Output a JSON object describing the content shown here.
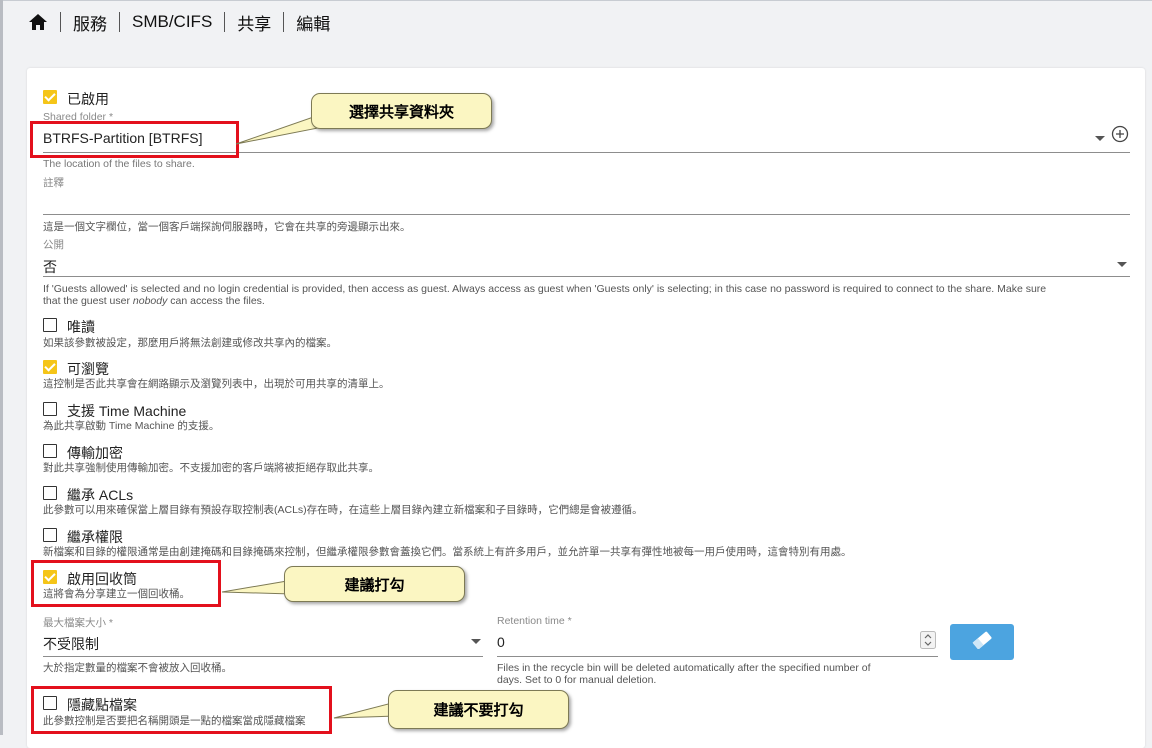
{
  "breadcrumb": {
    "items": [
      "服務",
      "SMB/CIFS",
      "共享",
      "編輯"
    ]
  },
  "form": {
    "enabled": {
      "label": "已啟用",
      "checked": true
    },
    "shared_folder": {
      "label": "Shared folder *",
      "value": "BTRFS-Partition [BTRFS]",
      "hint": "The location of the files to share."
    },
    "comment": {
      "label": "註釋",
      "value": "",
      "hint": "這是一個文字欄位，當一個客戶端探詢伺服器時，它會在共享的旁邊顯示出來。"
    },
    "public": {
      "label": "公開",
      "value": "否",
      "hint_a": "If 'Guests allowed' is selected and no login credential is provided, then access as guest. Always access as guest when 'Guests only' is selecting; in this case no password is required to connect to the share. Make sure",
      "hint_b1": "that the guest user ",
      "hint_b2": "nobody",
      "hint_b3": " can access the files."
    },
    "read_only": {
      "label": "唯讀",
      "checked": false,
      "hint": "如果該參數被設定，那麼用戶將無法創建或修改共享內的檔案。"
    },
    "browsable": {
      "label": "可瀏覽",
      "checked": true,
      "hint": "這控制是否此共享會在網路顯示及瀏覽列表中，出現於可用共享的清單上。"
    },
    "time_machine": {
      "label": "支援 Time Machine",
      "checked": false,
      "hint": "為此共享啟動 Time Machine 的支援。"
    },
    "transport_encryption": {
      "label": "傳輸加密",
      "checked": false,
      "hint": "對此共享強制使用傳輸加密。不支援加密的客戶端將被拒絕存取此共享。"
    },
    "inherit_acls": {
      "label": "繼承 ACLs",
      "checked": false,
      "hint": "此參數可以用來確保當上層目錄有預設存取控制表(ACLs)存在時，在這些上層目錄內建立新檔案和子目錄時，它們總是會被遵循。"
    },
    "inherit_permissions": {
      "label": "繼承權限",
      "checked": false,
      "hint": "新檔案和目錄的權限通常是由創建掩碼和目錄掩碼來控制，但繼承權限參數會蓋換它們。當系統上有許多用戶，並允許單一共享有彈性地被每一用戶使用時，這會特別有用處。"
    },
    "recycle_bin": {
      "label": "啟用回收筒",
      "checked": true,
      "hint": "這將會為分享建立一個回收桶。"
    },
    "max_file_size": {
      "label": "最大檔案大小 *",
      "value": "不受限制",
      "hint": "大於指定數量的檔案不會被放入回收桶。"
    },
    "retention_time": {
      "label": "Retention time *",
      "value": "0",
      "hint_a": "Files in the recycle bin will be deleted automatically after the specified number of",
      "hint_b": "days. Set to 0 for manual deletion."
    },
    "hide_dot_files": {
      "label": "隱藏點檔案",
      "checked": false,
      "hint": "此參數控制是否要把名稱開頭是一點的檔案當成隱藏檔案"
    }
  },
  "annotations": {
    "callout_folder": "選擇共享資料夾",
    "callout_recycle": "建議打勾",
    "callout_hidden": "建議不要打勾"
  },
  "colors": {
    "accent_yellow": "#f5c518",
    "annotation_red": "#e3101c",
    "button_blue": "#4ca4e0",
    "callout_fill": "#fbf6c2"
  },
  "icons": [
    "home-icon",
    "chevron-down-icon",
    "add-circle-icon",
    "spin-arrows-icon",
    "eraser-icon"
  ]
}
